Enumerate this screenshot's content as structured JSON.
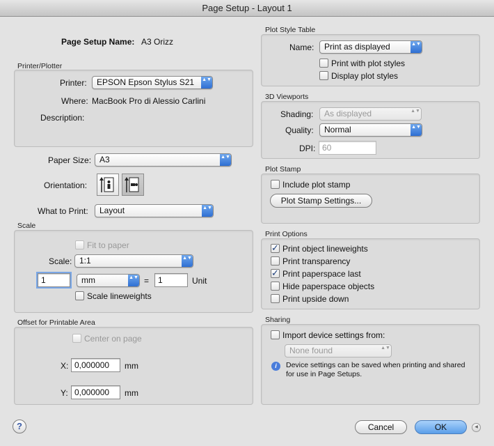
{
  "window": {
    "title": "Page Setup - Layout 1"
  },
  "left": {
    "page_setup_name_label": "Page Setup Name:",
    "page_setup_name_value": "A3 Orizz",
    "printer_group": {
      "title": "Printer/Plotter",
      "printer_label": "Printer:",
      "printer_value": "EPSON Epson Stylus S21",
      "where_label": "Where:",
      "where_value": "MacBook Pro di Alessio Carlini",
      "description_label": "Description:"
    },
    "paper_size_label": "Paper Size:",
    "paper_size_value": "A3",
    "orientation_label": "Orientation:",
    "orientation_selected": "landscape",
    "what_to_print_label": "What to Print:",
    "what_to_print_value": "Layout",
    "scale_group": {
      "title": "Scale",
      "fit_to_paper": "Fit to paper",
      "scale_label": "Scale:",
      "scale_value": "1:1",
      "scale_num": "1",
      "unit_value": "mm",
      "equals": "=",
      "scale_den": "1",
      "unit_label": "Unit",
      "scale_lineweights": "Scale lineweights"
    },
    "offset_group": {
      "title": "Offset for Printable Area",
      "center_on_page": "Center on page",
      "x_label": "X:",
      "x_value": "0,000000",
      "x_unit": "mm",
      "y_label": "Y:",
      "y_value": "0,000000",
      "y_unit": "mm"
    }
  },
  "right": {
    "plot_style_group": {
      "title": "Plot Style Table",
      "name_label": "Name:",
      "name_value": "Print as displayed",
      "print_with_plot_styles": "Print with plot styles",
      "display_plot_styles": "Display plot styles"
    },
    "viewports_group": {
      "title": "3D Viewports",
      "shading_label": "Shading:",
      "shading_value": "As displayed",
      "quality_label": "Quality:",
      "quality_value": "Normal",
      "dpi_label": "DPI:",
      "dpi_value": "60"
    },
    "plot_stamp_group": {
      "title": "Plot Stamp",
      "include_plot_stamp": "Include plot stamp",
      "settings_button": "Plot Stamp Settings..."
    },
    "print_options_group": {
      "title": "Print Options",
      "options": [
        {
          "label": "Print object lineweights",
          "checked": true
        },
        {
          "label": "Print transparency",
          "checked": false
        },
        {
          "label": "Print paperspace last",
          "checked": true
        },
        {
          "label": "Hide paperspace objects",
          "checked": false
        },
        {
          "label": "Print upside down",
          "checked": false
        }
      ]
    },
    "sharing_group": {
      "title": "Sharing",
      "import_device_settings": "Import device settings from:",
      "device_value": "None found",
      "info_text": "Device settings can be saved when printing and shared for use in Page Setups."
    }
  },
  "footer": {
    "help": "?",
    "cancel": "Cancel",
    "ok": "OK"
  },
  "icons": {
    "popup_arrows": "▲▼",
    "info": "i",
    "disclosure": "◀"
  }
}
